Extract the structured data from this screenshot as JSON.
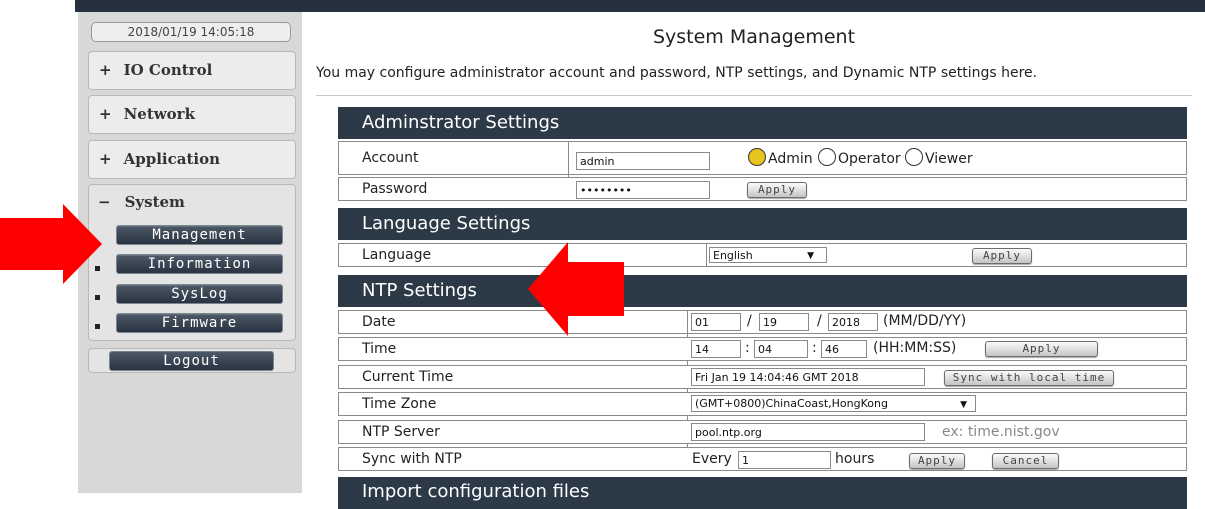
{
  "sidebar": {
    "datetime": "2018/01/19 14:05:18",
    "menu": [
      {
        "symbol": "+",
        "label": "IO Control"
      },
      {
        "symbol": "+",
        "label": "Network"
      },
      {
        "symbol": "+",
        "label": "Application"
      }
    ],
    "system": {
      "symbol": "−",
      "label": "System",
      "items": [
        "Management",
        "Information",
        "SysLog",
        "Firmware"
      ]
    },
    "logout_label": "Logout"
  },
  "page": {
    "title": "System Management",
    "description": "You may configure administrator account and password, NTP settings, and Dynamic NTP settings here."
  },
  "admin": {
    "header": "Adminstrator Settings",
    "account_label": "Account",
    "account_value": "admin",
    "password_label": "Password",
    "password_value": "••••••••",
    "roles": [
      "Admin",
      "Operator",
      "Viewer"
    ],
    "selected_role": "Admin",
    "apply_label": "Apply"
  },
  "language": {
    "header": "Language Settings",
    "label": "Language",
    "selected": "English",
    "arrow": "▼",
    "apply_label": "Apply"
  },
  "ntp": {
    "header": "NTP Settings",
    "date_label": "Date",
    "month": "01",
    "day": "19",
    "year": "2018",
    "sep": "/",
    "date_format": "(MM/DD/YY)",
    "time_label": "Time",
    "hour": "14",
    "minute": "04",
    "second": "46",
    "colon": ":",
    "time_format": "(HH:MM:SS)",
    "time_apply_label": "Apply",
    "current_time_label": "Current Time",
    "current_time_value": "Fri Jan 19 14:04:46 GMT 2018",
    "sync_local_label": "Sync with local time",
    "timezone_label": "Time Zone",
    "timezone_value": "(GMT+0800)ChinaCoast,HongKong",
    "server_label": "NTP Server",
    "server_value": "pool.ntp.org",
    "server_example": "ex: time.nist.gov",
    "sync_label": "Sync with NTP",
    "every_label": "Every",
    "every_value": "1",
    "hours_label": "hours",
    "sync_apply_label": "Apply",
    "cancel_label": "Cancel"
  },
  "next_section": {
    "header": "Import configuration files"
  },
  "colors": {
    "header_bg": "#2c3947",
    "sidebar_bg": "#d8d8d8",
    "selected_radio": "#e8c420",
    "arrow_red": "#ff0000"
  }
}
